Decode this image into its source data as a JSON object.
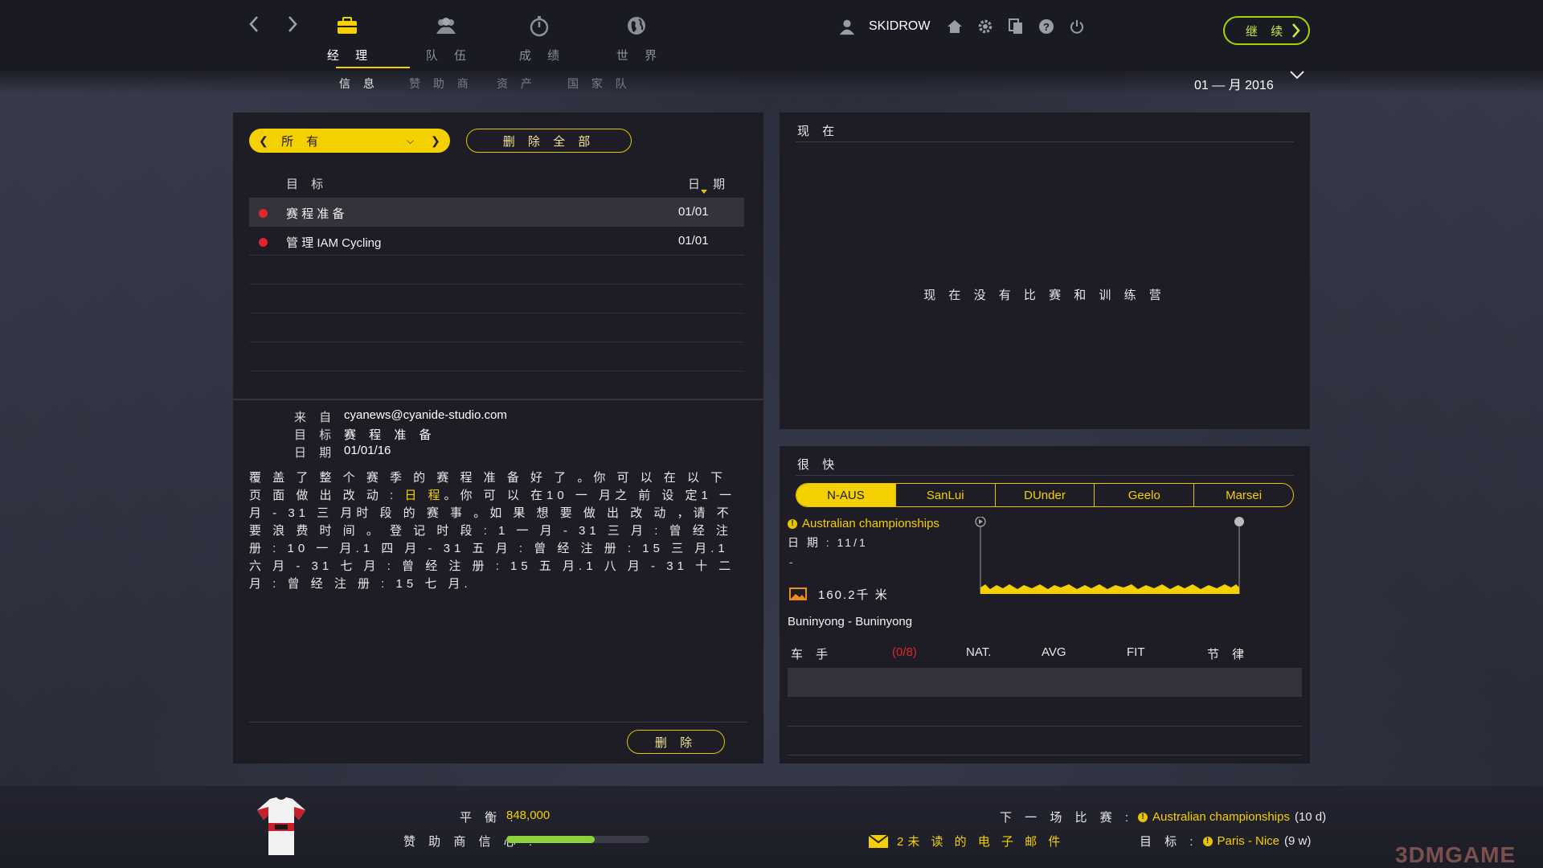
{
  "nav": {
    "back_icon": "chevron-left-icon",
    "forward_icon": "chevron-right-icon",
    "main_tabs": [
      {
        "label": "经 理",
        "icon": "briefcase-icon",
        "active": true
      },
      {
        "label": "队 伍",
        "icon": "team-icon",
        "active": false
      },
      {
        "label": "成 绩",
        "icon": "stopwatch-icon",
        "active": false
      },
      {
        "label": "世 界",
        "icon": "globe-icon",
        "active": false
      }
    ],
    "sub_tabs": [
      {
        "label": "信 息",
        "active": true
      },
      {
        "label": "赞 助 商",
        "active": false
      },
      {
        "label": "资 产",
        "active": false
      },
      {
        "label": "国 家 队",
        "active": false
      }
    ]
  },
  "user": {
    "name": "SKIDROW"
  },
  "continue_label": "继 续",
  "current_date": "01 — 月 2016",
  "messages": {
    "filter": "所 有",
    "delete_all_label": "删 除 全 部",
    "col_subject": "目 标",
    "col_date": "日 期",
    "rows": [
      {
        "subject": "赛 程 准 备",
        "date": "01/01",
        "unread": true
      },
      {
        "subject": "管 理 IAM Cycling",
        "date": "01/01",
        "unread": true
      }
    ],
    "detail": {
      "from_label": "来 自",
      "from": "cyanews@cyanide-studio.com",
      "subject_label": "目 标",
      "subject": "赛 程 准 备",
      "date_label": "日 期",
      "date": "01/01/16",
      "body_part1": "覆 盖 了 整 个 赛 季 的 赛 程 准 备 好 了 。你 可 以 在 以 下 页 面 做 出 改 动 : ",
      "body_link": "日 程",
      "body_part2": "。你 可 以 在10 一 月之 前 设 定1 一 月 - 31 三 月时 段 的 赛 事 。如 果 想 要 做 出 改 动 ，请 不 要 浪 费 时 间 。 登 记 时 段 : 1 一 月 - 31 三 月 : 曾 经 注 册 :  10 一 月.1 四 月 - 31 五 月 : 曾 经 注 册 :  15 三 月.1 六 月 - 31 七 月 : 曾 经 注 册 :  15 五 月.1 八 月 - 31 十 二 月 : 曾 经 注 册 :  15 七 月."
    },
    "delete_label": "删 除"
  },
  "now_panel": {
    "title": "现 在",
    "empty_text": "现 在 没 有 比 赛 和 训 练 营"
  },
  "soon_panel": {
    "title": "很 快",
    "race_tabs": [
      "N-AUS",
      "SanLui",
      "DUnder",
      "Geelo",
      "Marsei"
    ],
    "active_tab": 0,
    "race_name": "Australian championships",
    "race_date": "日 期 : 11/1",
    "dash": "-",
    "distance": "160.2千 米",
    "route": "Buninyong - Buninyong",
    "rider_cols": {
      "rider": "车 手",
      "count": "(0/8)",
      "nat": "NAT.",
      "avg": "AVG",
      "fit": "FIT",
      "rhythm": "节 律"
    }
  },
  "footer": {
    "balance_label": "平 衡 :",
    "balance_value": "848,000",
    "confidence_label": "赞 助 商 信 心 :",
    "confidence_level": 0.62,
    "mail_text": "2未 读 的 电 子 邮 件",
    "next_race_label": "下 一 场 比 赛 :",
    "next_race_name": "Australian championships",
    "next_race_days": "(10 d)",
    "goal_label": "目 标 :",
    "goal_name": "Paris - Nice",
    "goal_weeks": "(9 w)",
    "watermark": "3DMGAME"
  },
  "colors": {
    "accent": "#f5d000",
    "continue": "#a8d200",
    "unread": "#e0262c",
    "confidence": "#8bd23a"
  }
}
